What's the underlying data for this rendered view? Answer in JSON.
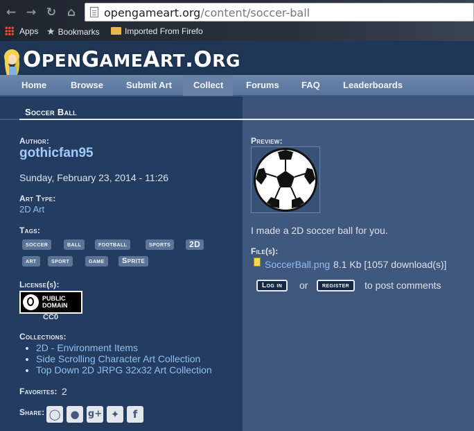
{
  "browser": {
    "url_domain": "opengameart.org",
    "url_path": "/content/soccer-ball",
    "bookmarks": [
      "Apps",
      "Bookmarks",
      "Imported From Firefo"
    ]
  },
  "site": {
    "logo_parts": [
      "O",
      "PEN",
      "G",
      "AME",
      "A",
      "RT",
      ".O",
      "RG"
    ],
    "nav": [
      "Home",
      "Browse",
      "Submit Art",
      "Collect",
      "Forums",
      "FAQ",
      "Leaderboards"
    ]
  },
  "page": {
    "title": "Soccer Ball",
    "author_label": "Author:",
    "author": "gothicfan95",
    "date": "Sunday, February 23, 2014 - 11:26",
    "art_type_label": "Art Type:",
    "art_type": "2D Art",
    "tags_label": "Tags:",
    "tags": [
      "soccer",
      "ball",
      "football",
      "sports",
      "2D",
      "art",
      "sport",
      "game",
      "Sprite"
    ],
    "license_label": "License(s):",
    "license_badge_line1": "PUBLIC",
    "license_badge_line2": "DOMAIN",
    "license_name": "CC0",
    "collections_label": "Collections:",
    "collections": [
      "2D - Environment Items",
      "Side Scrolling Character Art Collection",
      "Top Down 2D JRPG 32x32 Art Collection"
    ],
    "favorites_label": "Favorites:",
    "favorites": "2",
    "share_label": "Share:",
    "share_icons": [
      "identica-icon",
      "reddit-icon",
      "google-plus-icon",
      "twitter-icon",
      "facebook-icon"
    ],
    "preview_label": "Preview:",
    "description": "I made a 2D soccer ball for you.",
    "files_label": "File(s):",
    "file_name": "SoccerBall.png",
    "file_info": "8.1 Kb [1057 download(s)]",
    "login_label": "Log in",
    "or_text": "or",
    "register_label": "register",
    "post_comments_text": "to post comments"
  }
}
